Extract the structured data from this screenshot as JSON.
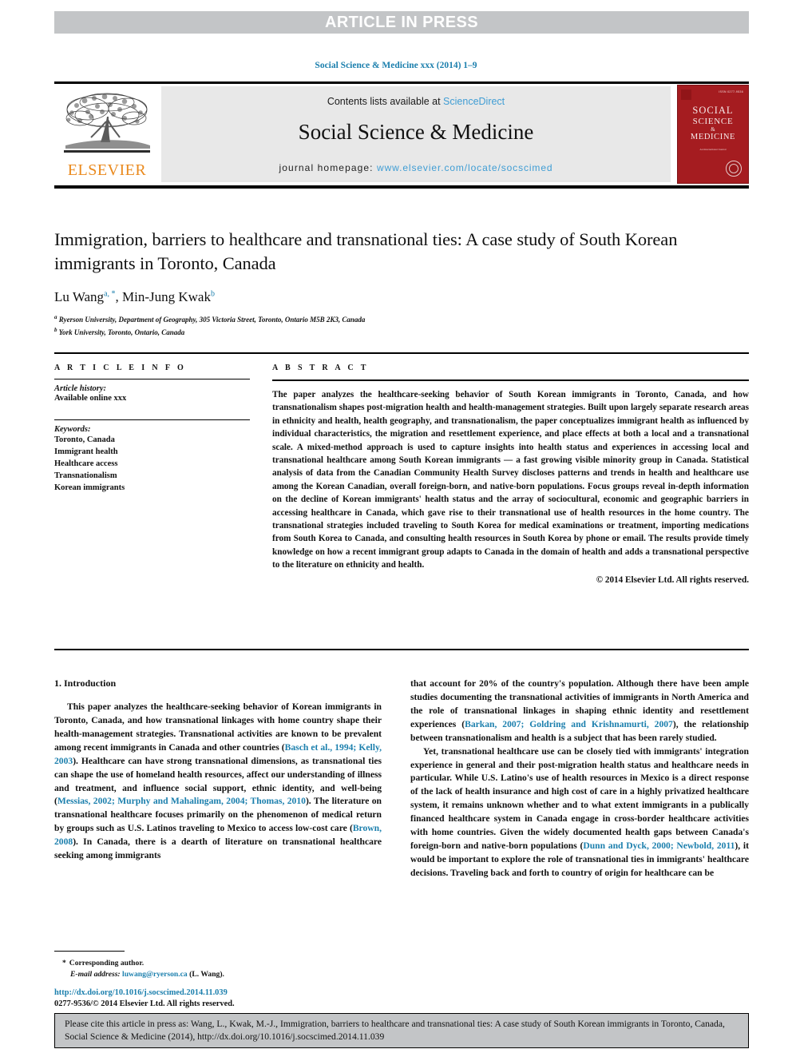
{
  "banner": {
    "label": "ARTICLE IN PRESS",
    "bg_color": "#c3c5c7"
  },
  "journal_ref": "Social Science & Medicine xxx (2014) 1–9",
  "masthead": {
    "contents_prefix": "Contents lists available at ",
    "contents_link": "ScienceDirect",
    "journal_title": "Social Science & Medicine",
    "homepage_prefix": "journal homepage: ",
    "homepage_url": "www.elsevier.com/locate/socscimed",
    "publisher": "ELSEVIER",
    "publisher_color": "#ea8a1e",
    "link_color": "#3f9dd4",
    "panel_bg": "#e8e8e8",
    "cover": {
      "issn": "ISSN 0277-9536",
      "line1": "SOCIAL",
      "line2": "SCIENCE",
      "amp": "&",
      "line3": "MEDICINE",
      "subtitle": "An International Journal",
      "bg_color": "#a51c20"
    }
  },
  "article": {
    "title": "Immigration, barriers to healthcare and transnational ties: A case study of South Korean immigrants in Toronto, Canada",
    "authors": [
      {
        "name": "Lu Wang",
        "marks": "a, *"
      },
      {
        "name": "Min-Jung Kwak",
        "marks": "b"
      }
    ],
    "affiliations": [
      {
        "mark": "a",
        "text": "Ryerson University, Department of Geography, 305 Victoria Street, Toronto, Ontario M5B 2K3, Canada"
      },
      {
        "mark": "b",
        "text": "York University, Toronto, Ontario, Canada"
      }
    ]
  },
  "info": {
    "heading": "A R T I C L E   I N F O",
    "history_label": "Article history:",
    "history_value": "Available online xxx",
    "keywords_label": "Keywords:",
    "keywords": [
      "Toronto, Canada",
      "Immigrant health",
      "Healthcare access",
      "Transnationalism",
      "Korean immigrants"
    ]
  },
  "abstract": {
    "heading": "A B S T R A C T",
    "body": "The paper analyzes the healthcare-seeking behavior of South Korean immigrants in Toronto, Canada, and how transnationalism shapes post-migration health and health-management strategies. Built upon largely separate research areas in ethnicity and health, health geography, and transnationalism, the paper conceptualizes immigrant health as influenced by individual characteristics, the migration and resettlement experience, and place effects at both a local and a transnational scale. A mixed-method approach is used to capture insights into health status and experiences in accessing local and transnational healthcare among South Korean immigrants — a fast growing visible minority group in Canada. Statistical analysis of data from the Canadian Community Health Survey discloses patterns and trends in health and healthcare use among the Korean Canadian, overall foreign-born, and native-born populations. Focus groups reveal in-depth information on the decline of Korean immigrants' health status and the array of sociocultural, economic and geographic barriers in accessing healthcare in Canada, which gave rise to their transnational use of health resources in the home country. The transnational strategies included traveling to South Korea for medical examinations or treatment, importing medications from South Korea to Canada, and consulting health resources in South Korea by phone or email. The results provide timely knowledge on how a recent immigrant group adapts to Canada in the domain of health and adds a transnational perspective to the literature on ethnicity and health.",
    "copyright": "© 2014 Elsevier Ltd. All rights reserved."
  },
  "body": {
    "section_heading": "1. Introduction",
    "left_paragraph_1_a": "This paper analyzes the healthcare-seeking behavior of Korean immigrants in Toronto, Canada, and how transnational linkages with home country shape their health-management strategies. Transnational activities are known to be prevalent among recent immigrants in Canada and other countries (",
    "left_ref_1": "Basch et al., 1994; Kelly, 2003",
    "left_paragraph_1_b": "). Healthcare can have strong transnational dimensions, as transnational ties can shape the use of homeland health resources, affect our understanding of illness and treatment, and influence social support, ethnic identity, and well-being (",
    "left_ref_2": "Messias, 2002; Murphy and Mahalingam, 2004; Thomas, 2010",
    "left_paragraph_1_c": "). The literature on transnational healthcare focuses primarily on the phenomenon of medical return by groups such as U.S. Latinos traveling to Mexico to access low-cost care (",
    "left_ref_3": "Brown, 2008",
    "left_paragraph_1_d": "). In Canada, there is a dearth of literature on transnational healthcare seeking among immigrants",
    "right_paragraph_1_a": "that account for 20% of the country's population. Although there have been ample studies documenting the transnational activities of immigrants in North America and the role of transnational linkages in shaping ethnic identity and resettlement experiences (",
    "right_ref_1": "Barkan, 2007; Goldring and Krishnamurti, 2007",
    "right_paragraph_1_b": "), the relationship between transnationalism and health is a subject that has been rarely studied.",
    "right_paragraph_2_a": "Yet, transnational healthcare use can be closely tied with immigrants' integration experience in general and their post-migration health status and healthcare needs in particular. While U.S. Latino's use of health resources in Mexico is a direct response of the lack of health insurance and high cost of care in a highly privatized healthcare system, it remains unknown whether and to what extent immigrants in a publically financed healthcare system in Canada engage in cross-border healthcare activities with home countries. Given the widely documented health gaps between Canada's foreign-born and native-born populations (",
    "right_ref_2": "Dunn and Dyck, 2000; Newbold, 2011",
    "right_paragraph_2_b": "), it would be important to explore the role of transnational ties in immigrants' healthcare decisions. Traveling back and forth to country of origin for healthcare can be"
  },
  "footnote": {
    "corresponding_star": "*",
    "corresponding_label": "Corresponding author.",
    "email_label": "E-mail address:",
    "email_value": "luwang@ryerson.ca",
    "email_owner": "(L. Wang).",
    "doi_url": "http://dx.doi.org/10.1016/j.socscimed.2014.11.039",
    "issn_copyright": "0277-9536/© 2014 Elsevier Ltd. All rights reserved.",
    "link_color": "#1b7fad"
  },
  "cite_footer": {
    "text": "Please cite this article in press as: Wang, L., Kwak, M.-J., Immigration, barriers to healthcare and transnational ties: A case study of South Korean immigrants in Toronto, Canada, Social Science & Medicine (2014), http://dx.doi.org/10.1016/j.socscimed.2014.11.039",
    "bg_color": "#c3c5c7"
  }
}
